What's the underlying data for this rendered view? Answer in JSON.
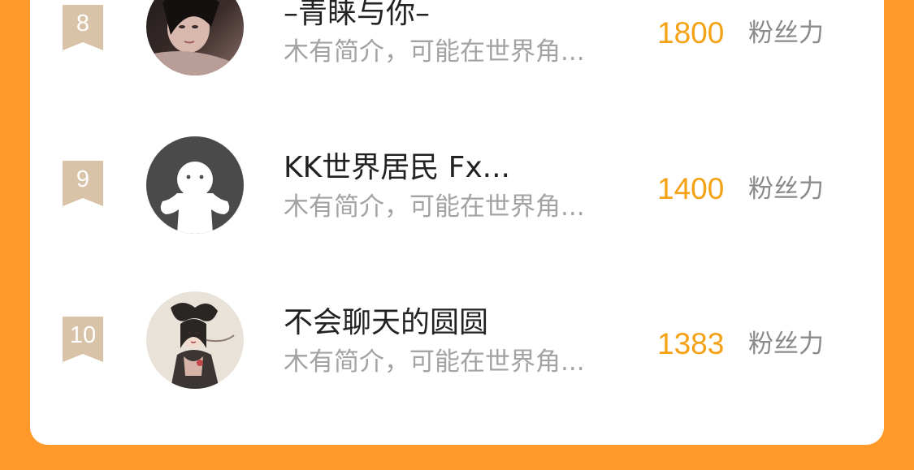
{
  "colors": {
    "background": "#FF9A2A",
    "card": "#FFFFFF",
    "badge": "#D9C3A8",
    "count": "#F5A114",
    "name": "#222222",
    "bio": "#A3A3A3",
    "label": "#8A8A8A"
  },
  "ranking": {
    "items": [
      {
        "rank": "8",
        "name": "–青睐与你–",
        "bio": "木有简介，可能在世界角...",
        "fans": "1800",
        "fans_label": "粉丝力",
        "avatar_icon": "avatar-photo-icon"
      },
      {
        "rank": "9",
        "name": "KK世界居民  Fx...",
        "bio": "木有简介，可能在世界角...",
        "fans": "1400",
        "fans_label": "粉丝力",
        "avatar_icon": "default-avatar-icon"
      },
      {
        "rank": "10",
        "name": "不会聊天的圆圆",
        "bio": "木有简介，可能在世界角...",
        "fans": "1383",
        "fans_label": "粉丝力",
        "avatar_icon": "avatar-illustration-icon"
      }
    ]
  }
}
